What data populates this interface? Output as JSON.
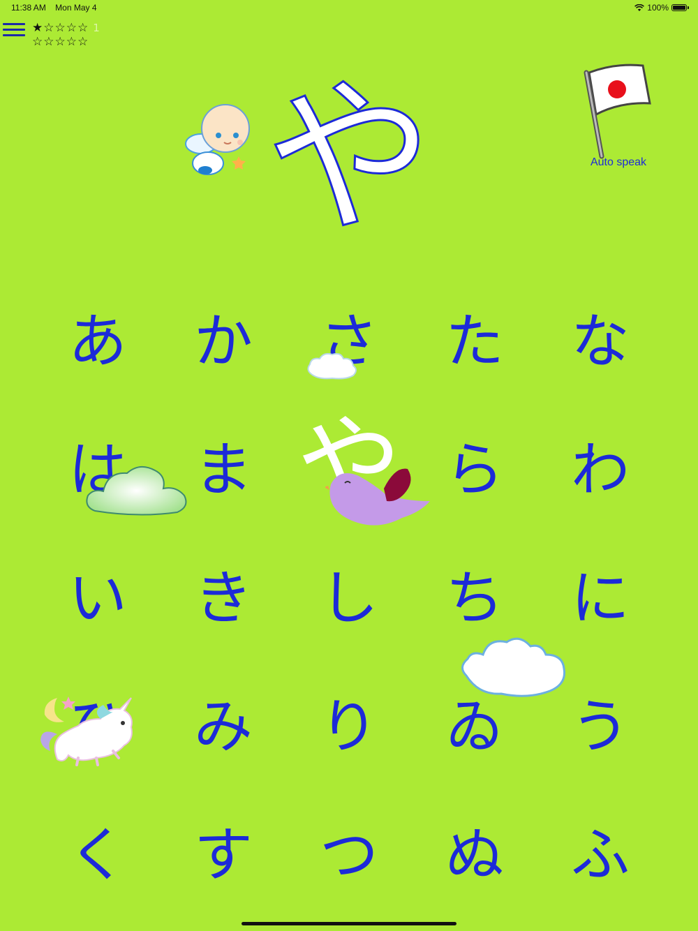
{
  "status_bar": {
    "time": "11:38 AM",
    "date": "Mon May 4",
    "battery": "100%"
  },
  "toolbar": {
    "stars_row1": "★☆☆☆☆",
    "stars_row2": "☆☆☆☆☆",
    "star_count": "1"
  },
  "main": {
    "current_kana": "や",
    "auto_speak_label": "Auto speak"
  },
  "grid": {
    "kana": [
      "あ",
      "か",
      "さ",
      "た",
      "な",
      "は",
      "ま",
      "や",
      "ら",
      "わ",
      "い",
      "き",
      "し",
      "ち",
      "に",
      "ひ",
      "み",
      "り",
      "ゐ",
      "う",
      "く",
      "す",
      "つ",
      "ぬ",
      "ふ"
    ],
    "selected_index": 7
  },
  "colors": {
    "background": "#acea34",
    "kana": "#1c2ad8",
    "highlight": "#ffffff"
  },
  "icons": [
    "menu-icon",
    "baby-angel-icon",
    "japan-flag-icon",
    "cloud-icon",
    "bird-icon",
    "unicorn-icon",
    "wifi-icon",
    "battery-icon"
  ]
}
